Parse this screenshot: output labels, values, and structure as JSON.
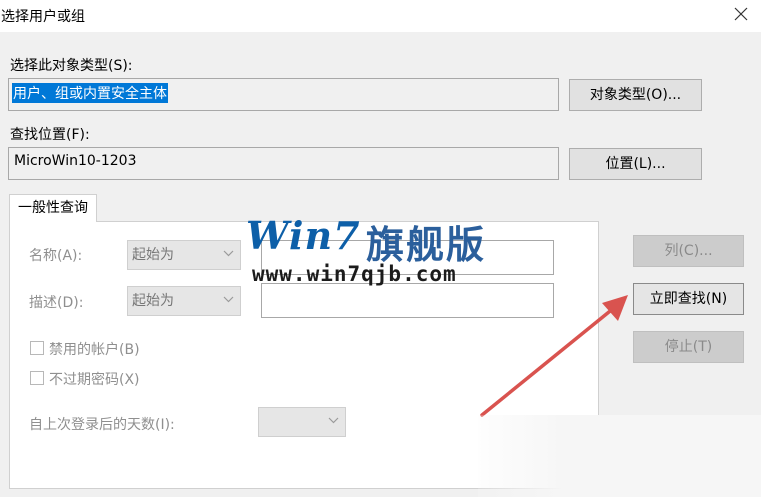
{
  "window": {
    "title": "选择用户或组"
  },
  "object_type": {
    "label": "选择此对象类型(S):",
    "value": "用户、组或内置安全主体",
    "button": "对象类型(O)..."
  },
  "location": {
    "label": "查找位置(F):",
    "value": "MicroWin10-1203",
    "button": "位置(L)..."
  },
  "tab": {
    "label": "一般性查询",
    "name_label": "名称(A):",
    "name_mode": "起始为",
    "desc_label": "描述(D):",
    "desc_mode": "起始为",
    "disabled_accounts": "禁用的帐户(B)",
    "non_expiring_pw": "不过期密码(X)",
    "days_label": "自上次登录后的天数(I):"
  },
  "buttons": {
    "columns": "列(C)...",
    "find_now": "立即查找(N)",
    "stop": "停止(T)"
  },
  "watermark": {
    "brand_latin": "Win",
    "brand_seven": "7",
    "brand_cn": "旗舰版",
    "url": "www.win7qjb.com"
  },
  "colors": {
    "selection": "#0078d7",
    "arrow": "#d9534f",
    "watermark_blue": "#0d5fa8"
  }
}
